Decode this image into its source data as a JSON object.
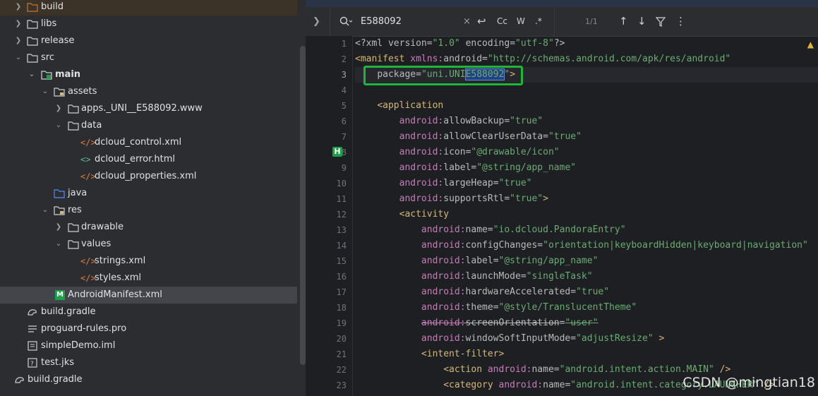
{
  "project_tree": {
    "items": [
      {
        "label": "build",
        "type": "folder",
        "expanded": false
      },
      {
        "label": "libs",
        "type": "folder",
        "expanded": false
      },
      {
        "label": "release",
        "type": "folder",
        "expanded": false
      },
      {
        "label": "src",
        "type": "folder",
        "expanded": true
      },
      {
        "label": "main",
        "type": "folder",
        "expanded": true
      },
      {
        "label": "assets",
        "type": "folder",
        "expanded": true
      },
      {
        "label": "apps._UNI__E588092.www",
        "type": "folder",
        "expanded": false
      },
      {
        "label": "data",
        "type": "folder",
        "expanded": true
      },
      {
        "label": "dcloud_control.xml",
        "type": "xml"
      },
      {
        "label": "dcloud_error.html",
        "type": "html"
      },
      {
        "label": "dcloud_properties.xml",
        "type": "xml"
      },
      {
        "label": "java",
        "type": "folder"
      },
      {
        "label": "res",
        "type": "folder",
        "expanded": true
      },
      {
        "label": "drawable",
        "type": "folder",
        "expanded": false
      },
      {
        "label": "values",
        "type": "folder",
        "expanded": true
      },
      {
        "label": "strings.xml",
        "type": "xml"
      },
      {
        "label": "styles.xml",
        "type": "xml"
      },
      {
        "label": "AndroidManifest.xml",
        "type": "manifest",
        "selected": true
      },
      {
        "label": "build.gradle",
        "type": "gradle"
      },
      {
        "label": "proguard-rules.pro",
        "type": "text"
      },
      {
        "label": "simpleDemo.iml",
        "type": "iml"
      },
      {
        "label": "test.jks",
        "type": "jks"
      },
      {
        "label": "build.gradle",
        "type": "gradle"
      }
    ]
  },
  "find_bar": {
    "query": "E588092",
    "match_count": "1/1",
    "case_label": "Cc",
    "word_label": "W",
    "regex_label": ".*"
  },
  "editor": {
    "line_numbers": [
      "1",
      "2",
      "3",
      "4",
      "5",
      "6",
      "7",
      "8",
      "9",
      "10",
      "11",
      "12",
      "13",
      "14",
      "15",
      "16",
      "17",
      "18",
      "19",
      "20",
      "21",
      "22",
      "23"
    ],
    "gutter_badge": "H",
    "watermark": "CSDN @mingtian18",
    "lines": [
      "<?xml version=\"1.0\" encoding=\"utf-8\"?>",
      "<manifest xmlns:android=\"http://schemas.android.com/apk/res/android\"",
      "    package=\"uni.UNIE588092\">",
      "",
      "    <application",
      "        android:allowBackup=\"true\"",
      "        android:allowClearUserData=\"true\"",
      "        android:icon=\"@drawable/icon\"",
      "        android:label=\"@string/app_name\"",
      "        android:largeHeap=\"true\"",
      "        android:supportsRtl=\"true\">",
      "        <activity",
      "            android:name=\"io.dcloud.PandoraEntry\"",
      "            android:configChanges=\"orientation|keyboardHidden|keyboard|navigation\"",
      "            android:label=\"@string/app_name\"",
      "            android:launchMode=\"singleTask\"",
      "            android:hardwareAccelerated=\"true\"",
      "            android:theme=\"@style/TranslucentTheme\"",
      "            android:screenOrientation=\"user\"",
      "            android:windowSoftInputMode=\"adjustResize\" >",
      "            <intent-filter>",
      "                <action android:name=\"android.intent.action.MAIN\" />",
      "                <category android:name=\"android.intent.category.LAUNCHER\" />"
    ]
  },
  "colors": {
    "bg": "#1e1f22",
    "panel": "#2b2d30",
    "tag": "#d5b778",
    "namespace": "#c77dbb",
    "value": "#6aab73",
    "highlight_box": "#1fb53a"
  }
}
